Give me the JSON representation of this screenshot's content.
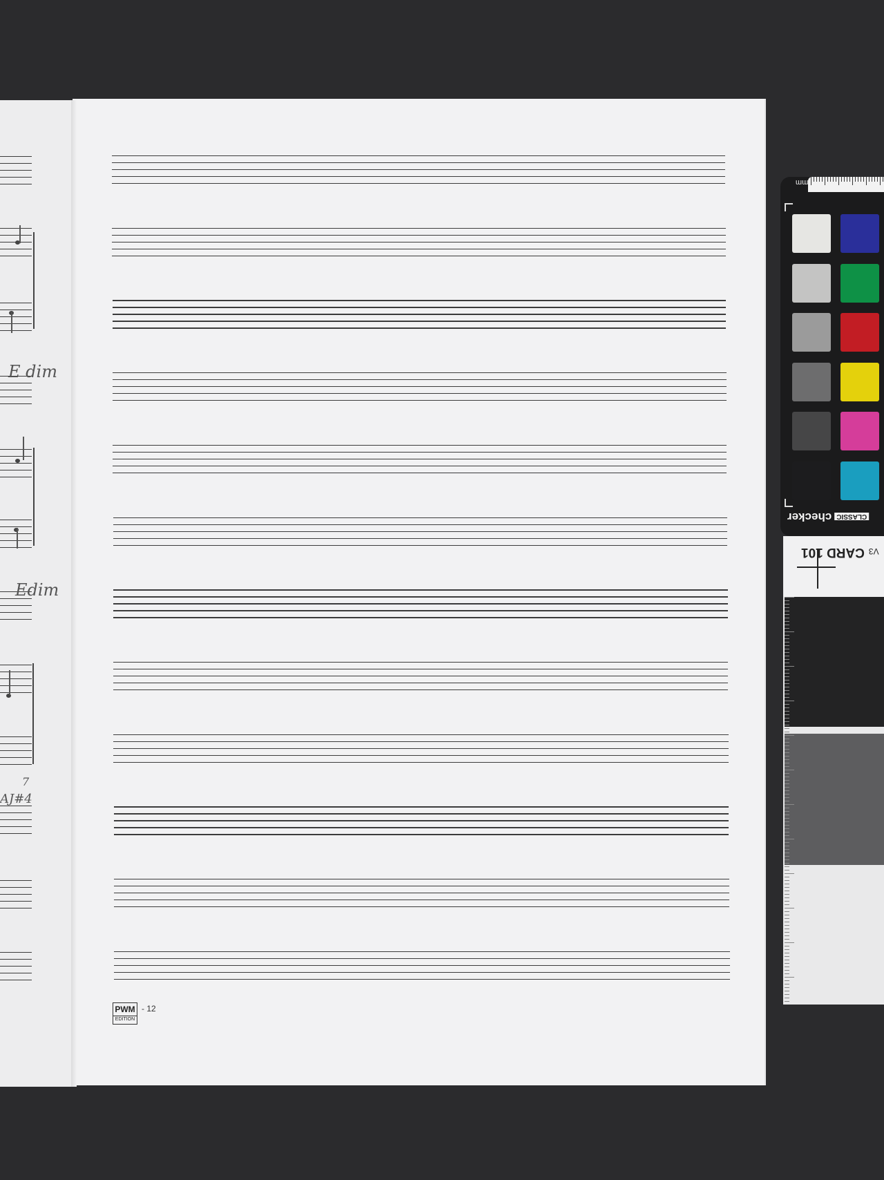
{
  "score_page": {
    "publisher_logo_top": "PWM",
    "publisher_logo_bottom": "EDITION",
    "page_number": "- 12",
    "staff_count": 12
  },
  "left_page_annotations": [
    {
      "text": "E dim"
    },
    {
      "text": "Edim"
    },
    {
      "text": "AJ#4"
    },
    {
      "text": "7"
    }
  ],
  "color_checker": {
    "brand_text": "checker",
    "brand_tag": "CLASSIC",
    "unit_label": "mm",
    "card_label": "CARD 101",
    "card_version": "V3",
    "grays": [
      "#e6e6e3",
      "#c4c4c3",
      "#9b9b9b",
      "#6d6d6e",
      "#464647",
      "#1c1c1e"
    ],
    "colors": [
      "#2a2f9a",
      "#0e9146",
      "#c21d24",
      "#e4d10c",
      "#d53d9a",
      "#1a9ebf"
    ],
    "card_swatches": [
      "#232324",
      "#5d5d5f",
      "#e9e9ea"
    ]
  }
}
